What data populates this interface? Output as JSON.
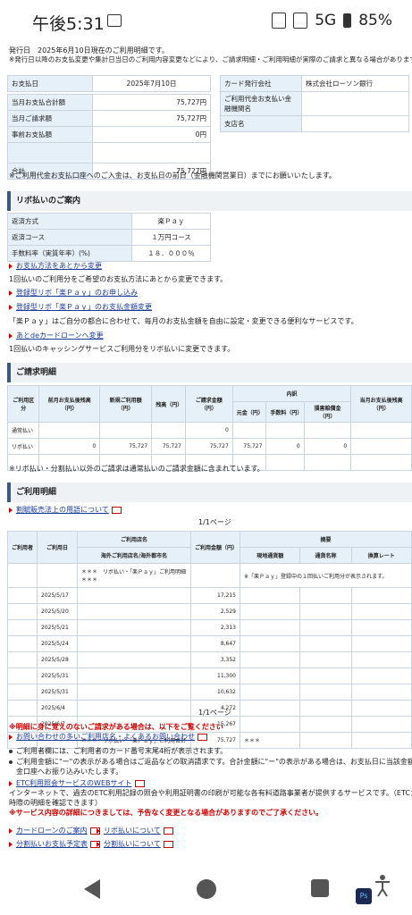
{
  "status": {
    "time": "午後5:31",
    "network": "5G",
    "battery": "85%"
  },
  "notice": {
    "line1": "発行日　2025年6月10日現在のご利用明細です。",
    "line2": "※発行日以降のお支払変更や集計日当日のご利用内容変更などにより、ご請求明細・ご利用明細が実際のご請求と異なる場合があります。"
  },
  "summary": {
    "pay_date_label": "お支払日",
    "pay_date": "2025年7月10日",
    "rows": [
      {
        "label": "当月お支払合計額",
        "value": "75,727円"
      },
      {
        "label": "当月ご請求額",
        "value": "75,727円"
      },
      {
        "label": "事前お支払額",
        "value": "0円"
      },
      {
        "label": "合計",
        "value": "75,727円"
      }
    ],
    "bank_rows": [
      {
        "label": "カード発行会社",
        "value": "株式会社ローソン銀行"
      },
      {
        "label": "ご利用代金お支払い金融機関名",
        "value": ""
      },
      {
        "label": "支店名",
        "value": ""
      }
    ],
    "note": "※ご利用代金お支払口座へのご入金は、お支払日の前日（金融機関営業日）までにお願いいたします。"
  },
  "revo": {
    "heading": "リボ払いのご案内",
    "rows": [
      {
        "label": "返済方式",
        "value": "楽Ｐａｙ"
      },
      {
        "label": "返済コース",
        "value": "１万円コース"
      },
      {
        "label": "手数料率（実質年率）(%)",
        "value": "１８．０００％"
      }
    ],
    "link1": "お支払方法をあとから変更",
    "text1": "1回払いのご利用分をご希望のお支払方法にあとから変更できます。",
    "link2": "登録型リボ「楽Ｐａｙ」のお申し込み",
    "link3": "登録型リボ「楽Ｐａｙ」のお支払金額変更",
    "text2": "「楽Ｐａｙ」はご自分の都合に合わせて、毎月のお支払金額を自由に設定・変更できる便利なサービスです。",
    "link4": "あとdeカードローンへ変更",
    "text3": "1回払いのキャッシングサービスご利用分をリボ払いに変更できます。"
  },
  "billing": {
    "heading": "ご請求明細",
    "headers": [
      "ご利用区分",
      "前月お支払後残高（円）",
      "新規ご利用額（円）",
      "残高（円）",
      "ご請求金額（円）",
      "内訳",
      "元金（円）",
      "手数料（円）",
      "損害賠償金（円）",
      "当月お支払後残高（円）"
    ],
    "rows": [
      {
        "kind": "通常払い",
        "prev": "",
        "new": "",
        "bal": "",
        "bill": "0",
        "principal": "",
        "fee": "",
        "damage": "",
        "after": ""
      },
      {
        "kind": "リボ払い",
        "prev": "0",
        "new": "75,727",
        "bal": "75,727",
        "bill": "75,727",
        "principal": "75,727",
        "fee": "0",
        "damage": "0",
        "after": ""
      }
    ],
    "note": "※リボ払い・分割払い以外のご請求は通常払いのご請求金額に含まれています。"
  },
  "usage": {
    "heading": "ご利用明細",
    "link": "割賦販売法上の用語について",
    "page": "1/1ページ",
    "headers": {
      "user": "ご利用者",
      "date": "ご利用日",
      "store": "ご利用店名",
      "store_sub": "海外ご利用店名/海外都市名",
      "amount": "ご利用金額（円）",
      "summary": "摘要",
      "local": "現地通貨額",
      "currency": "通貨名称",
      "rate": "換算レート"
    },
    "revo_row": {
      "mark": "＊＊＊",
      "store": "リボ払い・「楽Ｐａｙ」ご利用明細",
      "mark2": "＊＊＊",
      "summary": "※「楽Ｐａｙ」登録中の１回払いご利用分が表示されます。"
    },
    "rows": [
      {
        "date": "2025/5/17",
        "amount": "17,215"
      },
      {
        "date": "2025/5/20",
        "amount": "2,529"
      },
      {
        "date": "2025/5/21",
        "amount": "2,313"
      },
      {
        "date": "2025/5/24",
        "amount": "8,647"
      },
      {
        "date": "2025/5/28",
        "amount": "3,352"
      },
      {
        "date": "2025/5/31",
        "amount": "11,300"
      },
      {
        "date": "2025/5/31",
        "amount": "10,632"
      },
      {
        "date": "2025/6/4",
        "amount": "4,272"
      },
      {
        "date": "2025/6/7",
        "amount": "15,267"
      }
    ],
    "total_row": {
      "mark": "＊＊＊",
      "label": "リボ払い・「楽Ｐａｙ」ご利用合計",
      "amount": "75,727",
      "mark2": "＊＊＊"
    },
    "page2": "1/1ページ"
  },
  "footer": {
    "warn1": "※明細に身に覚えのないご請求がある場合は、以下をご覧ください",
    "link1": "お問い合わせの多いご利用店名・よくあるお問い合わせ",
    "bullet1": "ご利用者欄には、ご利用者のカード番号末尾4桁が表示されます。",
    "bullet2": "ご利用金額に\"ー\"の表示がある場合はご返品などの取消請求です。合計金額に\"ー\"の表示がある場合は、お支払日に当該金額をご指定の",
    "bullet2b": "金口座へお振り込みいたします。",
    "link2": "ETC利用照会サービスのWEBサイト",
    "text1": "インターネットで、過去のETC利用記録の照会や利用証明書の印刷が可能な各有料道路事業者が提供するサービスです。（ETCカードの利用",
    "text1b": "時際の明細を確認できます）",
    "warn2": "※サービス内容の詳細につきましては、予告なく変更となる場合がありますのでご了承ください。",
    "links": [
      "カードローンのご案内",
      "リボ払いについて",
      "分割払いお支払予定表",
      "分割払いについて"
    ]
  }
}
